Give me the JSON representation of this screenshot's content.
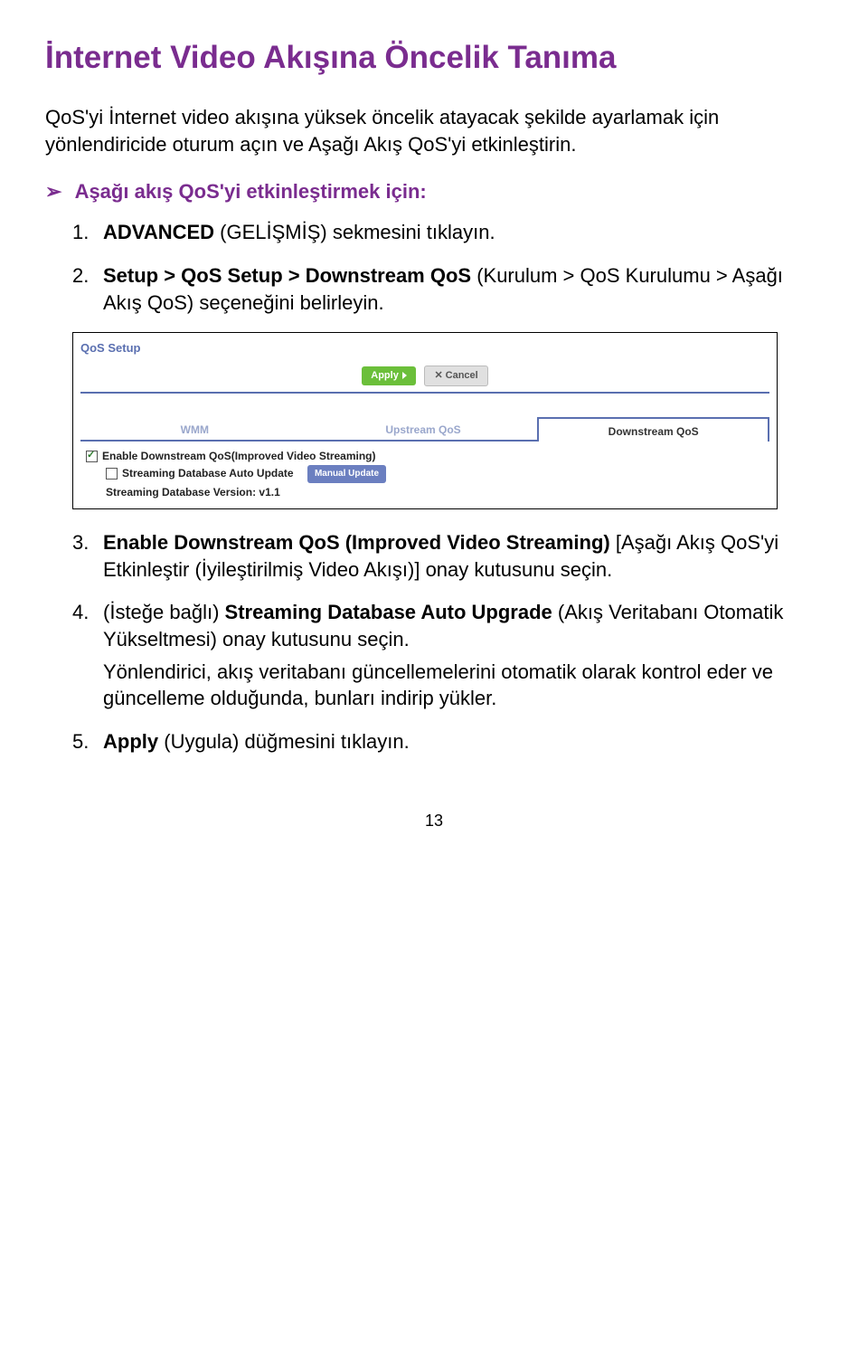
{
  "title": "İnternet Video Akışına Öncelik Tanıma",
  "intro": "QoS'yi İnternet video akışına yüksek öncelik atayacak şekilde ayarlamak için yönlendiricide oturum açın ve Aşağı Akış QoS'yi etkinleştirin.",
  "lead_arrow": "➢",
  "lead_text": "Aşağı akış QoS'yi etkinleştirmek için:",
  "steps": {
    "s1_num": "1.",
    "s1_a": "ADVANCED",
    "s1_b": " (GELİŞMİŞ) sekmesini tıklayın.",
    "s2_num": "2.",
    "s2_a": "Setup > QoS Setup > Downstream QoS",
    "s2_b": " (Kurulum > QoS Kurulumu > Aşağı Akış QoS) seçeneğini belirleyin.",
    "s3_num": "3.",
    "s3_a": "Enable Downstream QoS (Improved Video Streaming)",
    "s3_b": " [Aşağı Akış QoS'yi Etkinleştir (İyileştirilmiş Video Akışı)] onay kutusunu seçin.",
    "s4_num": "4.",
    "s4_a": "(İsteğe bağlı) ",
    "s4_b": "Streaming Database Auto Upgrade",
    "s4_c": " (Akış Veritabanı Otomatik Yükseltmesi) onay kutusunu seçin.",
    "s4_d": "Yönlendirici, akış veritabanı güncellemelerini otomatik olarak kontrol eder ve güncelleme olduğunda, bunları indirip yükler.",
    "s5_num": "5.",
    "s5_a": "Apply",
    "s5_b": " (Uygula) düğmesini tıklayın."
  },
  "figure": {
    "title": "QoS Setup",
    "apply": "Apply",
    "cancel": "Cancel",
    "tab1": "WMM",
    "tab2": "Upstream QoS",
    "tab3": "Downstream QoS",
    "chk1": "Enable Downstream QoS(Improved Video Streaming)",
    "chk2": "Streaming Database Auto Update",
    "manual": "Manual Update",
    "version": "Streaming Database Version: v1.1"
  },
  "page_number": "13"
}
